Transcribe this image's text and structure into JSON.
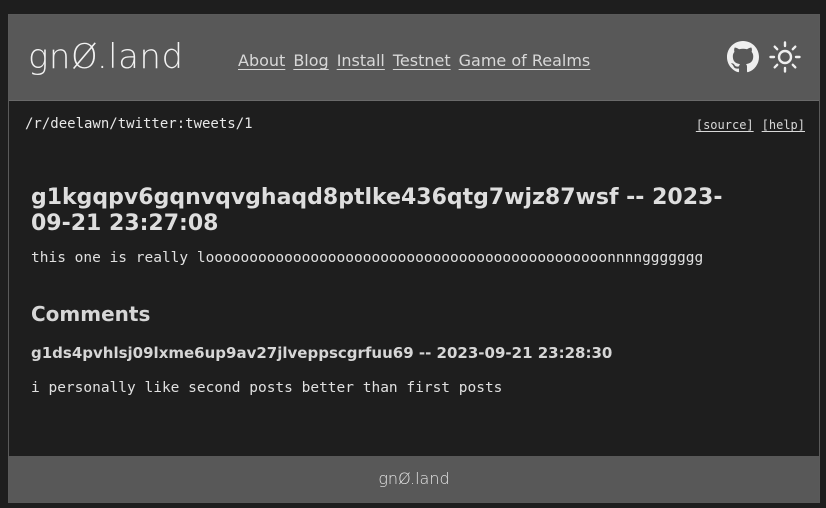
{
  "header": {
    "logo_text": "gnØ.land",
    "nav": [
      {
        "label": "About"
      },
      {
        "label": "Blog"
      },
      {
        "label": "Install"
      },
      {
        "label": "Testnet"
      },
      {
        "label": "Game of Realms"
      }
    ],
    "icons": {
      "github": "github-icon",
      "theme": "sun-icon"
    }
  },
  "path_bar": {
    "path": "/r/deelawn/twitter:tweets/1",
    "source_label": "[source]",
    "help_label": "[help]"
  },
  "post": {
    "title": "g1kgqpv6gqnvqvghaqd8ptlke436qtg7wjz87wsf -- 2023-09-21 23:27:08",
    "body": "this one is really loooooooooooooooooooooooooooooooooooooooooooooonnnnggggggg"
  },
  "comments": {
    "heading": "Comments",
    "items": [
      {
        "meta": "g1ds4pvhlsj09lxme6up9av27jlveppscgrfuu69 -- 2023-09-21 23:28:30",
        "body": "i personally like second posts better than first posts"
      }
    ]
  },
  "footer": {
    "logo_text": "gnØ.land"
  },
  "colors": {
    "page_bg": "#1e1e1e",
    "bar_bg": "#585858",
    "text": "#d9d9d9"
  }
}
